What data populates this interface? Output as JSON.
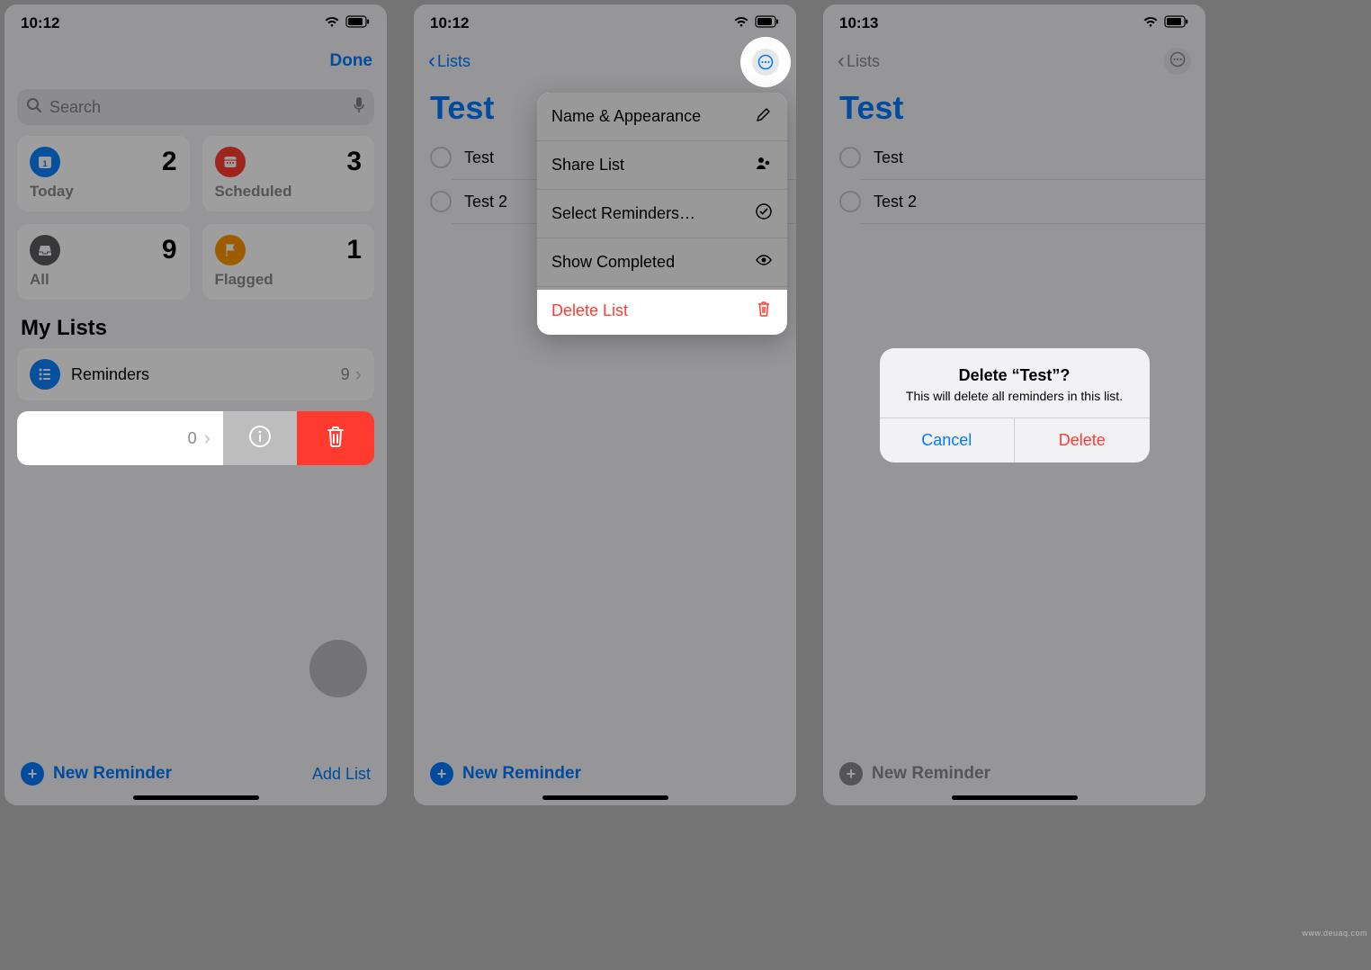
{
  "watermark": "www.deuaq.com",
  "common": {
    "wifi": "wifi-icon",
    "battery": "battery-icon"
  },
  "screen1": {
    "time": "10:12",
    "done": "Done",
    "search_placeholder": "Search",
    "cards": {
      "today": {
        "label": "Today",
        "count": "2"
      },
      "scheduled": {
        "label": "Scheduled",
        "count": "3"
      },
      "all": {
        "label": "All",
        "count": "9"
      },
      "flagged": {
        "label": "Flagged",
        "count": "1"
      }
    },
    "mylists_heading": "My Lists",
    "lists": {
      "reminders": {
        "name": "Reminders",
        "count": "9"
      }
    },
    "swiped_list_count": "0",
    "new_reminder": "New Reminder",
    "add_list": "Add List"
  },
  "screen2": {
    "time": "10:12",
    "back": "Lists",
    "title": "Test",
    "items": {
      "0": "Test",
      "1": "Test 2"
    },
    "menu": {
      "name_appearance": "Name & Appearance",
      "share_list": "Share List",
      "select_reminders": "Select Reminders…",
      "show_completed": "Show Completed",
      "delete_list": "Delete List"
    },
    "new_reminder": "New Reminder"
  },
  "screen3": {
    "time": "10:13",
    "back": "Lists",
    "title": "Test",
    "items": {
      "0": "Test",
      "1": "Test 2"
    },
    "alert": {
      "title": "Delete “Test”?",
      "message": "This will delete all reminders in this list.",
      "cancel": "Cancel",
      "delete": "Delete"
    },
    "new_reminder": "New Reminder"
  }
}
